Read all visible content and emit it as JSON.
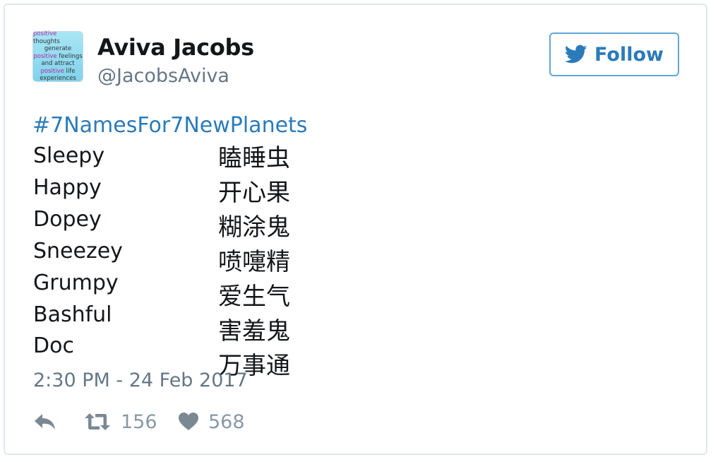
{
  "tweet": {
    "avatar": {
      "lines": [
        [
          {
            "t": "positive",
            "pink": true
          },
          {
            "t": " thoughts"
          }
        ],
        [
          {
            "t": "generate"
          }
        ],
        [
          {
            "t": "positive",
            "pink": true
          },
          {
            "t": " feelings"
          }
        ],
        [
          {
            "t": "and attract"
          }
        ],
        [
          {
            "t": "positive",
            "pink": true
          },
          {
            "t": " life"
          }
        ],
        [
          {
            "t": "experiences"
          }
        ]
      ]
    },
    "author_name": "Aviva Jacobs",
    "author_handle": "@JacobsAviva",
    "follow_label": "Follow",
    "follow_icon": "twitter-bird-icon",
    "hashtag": "#7NamesFor7NewPlanets",
    "names": [
      {
        "en": "Sleepy",
        "zh": "瞌睡虫"
      },
      {
        "en": "Happy",
        "zh": "开心果"
      },
      {
        "en": "Dopey",
        "zh": "糊涂鬼"
      },
      {
        "en": "Sneezey",
        "zh": "喷嚏精"
      },
      {
        "en": "Grumpy",
        "zh": "爱生气"
      },
      {
        "en": "Bashful",
        "zh": "害羞鬼"
      },
      {
        "en": "Doc",
        "zh": "万事通"
      }
    ],
    "timestamp": "2:30 PM - 24 Feb 2017",
    "actions": {
      "reply_icon": "reply-icon",
      "retweet_icon": "retweet-icon",
      "retweet_count": "156",
      "like_icon": "heart-icon",
      "like_count": "568"
    },
    "colors": {
      "link": "#2b7bb9",
      "text": "#14171a",
      "muted": "#657786",
      "border": "#e1e8ed"
    }
  }
}
